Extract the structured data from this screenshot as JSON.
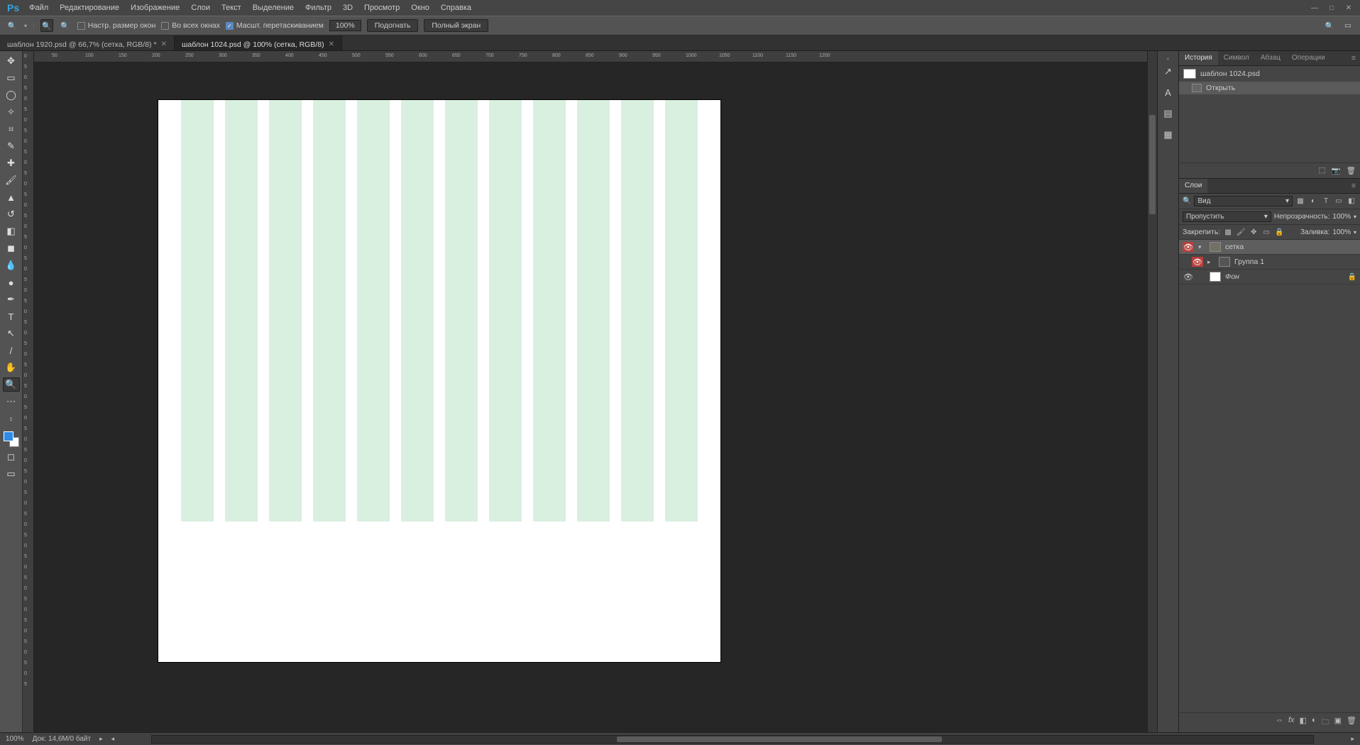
{
  "menubar": {
    "logo": "Ps",
    "items": [
      "Файл",
      "Редактирование",
      "Изображение",
      "Слои",
      "Текст",
      "Выделение",
      "Фильтр",
      "3D",
      "Просмотр",
      "Окно",
      "Справка"
    ]
  },
  "optionsbar": {
    "cb_resize": "Настр. размер окон",
    "cb_allwin": "Во всех окнах",
    "cb_scrubby": "Масшт. перетаскиванием",
    "zoom": "100%",
    "btn_fit": "Подогнать",
    "btn_full": "Полный экран"
  },
  "tabs": [
    {
      "label": "шаблон 1920.psd @ 66,7% (сетка, RGB/8) *",
      "active": false
    },
    {
      "label": "шаблон 1024.psd @ 100% (сетка, RGB/8)",
      "active": true
    }
  ],
  "ruler_h": [
    50,
    100,
    150,
    200,
    250,
    300,
    350,
    400,
    450,
    500,
    550,
    600,
    650,
    700,
    750,
    800,
    850,
    900,
    950,
    1000,
    1050,
    1100,
    1150,
    1200
  ],
  "ruler_v": [
    0,
    5,
    0,
    5,
    0,
    5,
    0,
    5,
    0,
    5,
    0,
    5,
    0,
    5,
    0,
    5,
    0,
    5,
    0,
    5,
    0,
    5,
    0,
    5,
    0,
    5,
    0,
    5,
    0,
    5,
    0,
    5,
    0,
    5,
    0,
    5,
    0,
    5,
    0,
    5,
    0,
    5,
    0,
    5,
    0,
    5,
    0,
    5,
    0,
    5,
    0,
    5,
    0,
    5,
    0,
    5,
    0,
    5,
    0,
    5
  ],
  "panels": {
    "history": {
      "tabs": [
        "История",
        "Символ",
        "Абзац",
        "Операции"
      ],
      "doc": "шаблон 1024.psd",
      "step": "Открыть"
    },
    "layers": {
      "tab": "Слои",
      "kind_label": "Вид",
      "mode": "Пропустить",
      "opacity_label": "Непрозрачность:",
      "opacity_value": "100%",
      "lock_label": "Закрепить:",
      "fill_label": "Заливка:",
      "fill_value": "100%",
      "items": [
        {
          "name": "сетка",
          "folder": true,
          "sel": true,
          "open": true,
          "redeye": true
        },
        {
          "name": "Группа 1",
          "folder": true,
          "sel": false,
          "open": false,
          "redeye": true
        },
        {
          "name": "Фон",
          "folder": false,
          "sel": false,
          "open": null,
          "redeye": false,
          "locked": true
        }
      ]
    }
  },
  "status": {
    "zoom": "100%",
    "doc": "Док: 14,6M/0 байт"
  }
}
